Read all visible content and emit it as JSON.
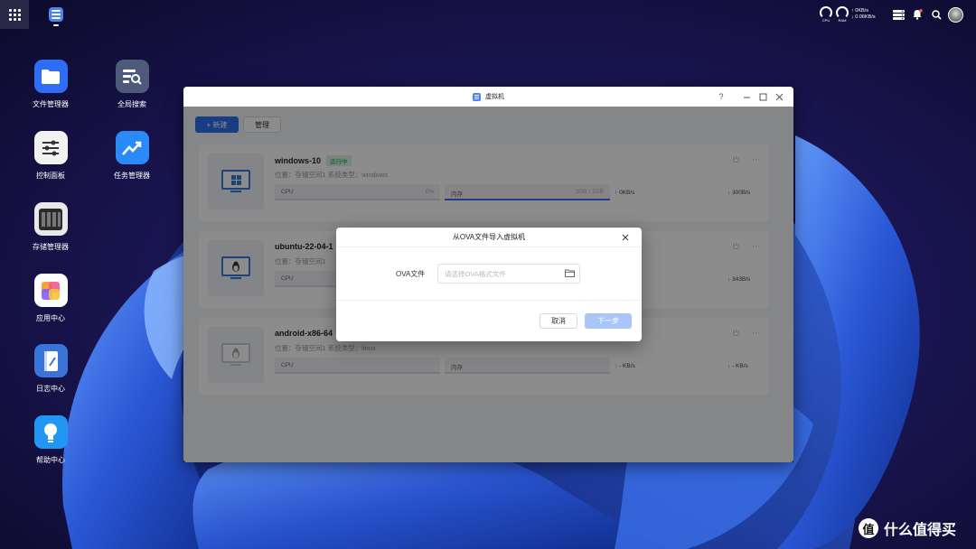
{
  "topbar": {
    "cpu_label": "CPU",
    "ram_label": "RAM",
    "upload": "↑ 0KB/s",
    "download": "↓ 0.06KB/s",
    "notification_dot": true
  },
  "desktop": {
    "icons": [
      {
        "label": "文件管理器",
        "icon": "folder-icon",
        "color": "#2f6df6"
      },
      {
        "label": "全局搜索",
        "icon": "global-search-icon",
        "color": "#4e5a7a"
      },
      {
        "label": "控制面板",
        "icon": "sliders-icon",
        "color": "#f2f2f2"
      },
      {
        "label": "任务管理器",
        "icon": "task-chart-icon",
        "color": "#2a8af7"
      },
      {
        "label": "存储管理器",
        "icon": "storage-icon",
        "color": "#2b2b2b"
      },
      {
        "label": "应用中心",
        "icon": "app-center-icon",
        "color": "#f6a23a"
      },
      {
        "label": "日志中心",
        "icon": "log-book-icon",
        "color": "#3b74d9"
      },
      {
        "label": "帮助中心",
        "icon": "lightbulb-icon",
        "color": "#2196f3"
      }
    ]
  },
  "window": {
    "title": "虚拟机",
    "help": "?",
    "toolbar": {
      "new_label": "+ 新建",
      "manage_label": "管理"
    },
    "vms": [
      {
        "name": "windows-10",
        "status": "运行中",
        "meta": "位置：存储空间1    系统类型：windows",
        "os_icon": "windows-logo-icon",
        "cpu_label": "CPU",
        "cpu_value": "0%",
        "cpu_fill": 0,
        "mem_label": "内存",
        "mem_value": "2GB / 2GB",
        "mem_fill": 1.0,
        "up": "0KB/s",
        "down": "300B/s"
      },
      {
        "name": "ubuntu-22-04-1",
        "status": "",
        "meta": "位置：存储空间1",
        "os_icon": "linux-penguin-icon",
        "cpu_label": "CPU",
        "cpu_value": "",
        "cpu_fill": 0,
        "mem_label": "",
        "mem_value": "",
        "mem_fill": 0,
        "up": "",
        "down": "343B/s"
      },
      {
        "name": "android-x86-64",
        "status": "",
        "meta": "位置：存储空间1    系统类型：linux",
        "os_icon": "linux-penguin-icon",
        "cpu_label": "CPU",
        "cpu_value": "",
        "cpu_fill": 0,
        "mem_label": "内存",
        "mem_value": "",
        "mem_fill": 0,
        "up": "- KB/s",
        "down": "- KB/s"
      }
    ]
  },
  "dialog": {
    "title": "从OVA文件导入虚拟机",
    "field_label": "OVA文件",
    "placeholder": "请选择OVA格式文件",
    "value": "",
    "cancel_label": "取消",
    "next_label": "下一步"
  },
  "watermark": {
    "text": "什么值得买",
    "logo": "值"
  },
  "colors": {
    "accent": "#2d6ff0",
    "running_badge": "#15a34a",
    "disabled_next": "#a9c6fb"
  }
}
